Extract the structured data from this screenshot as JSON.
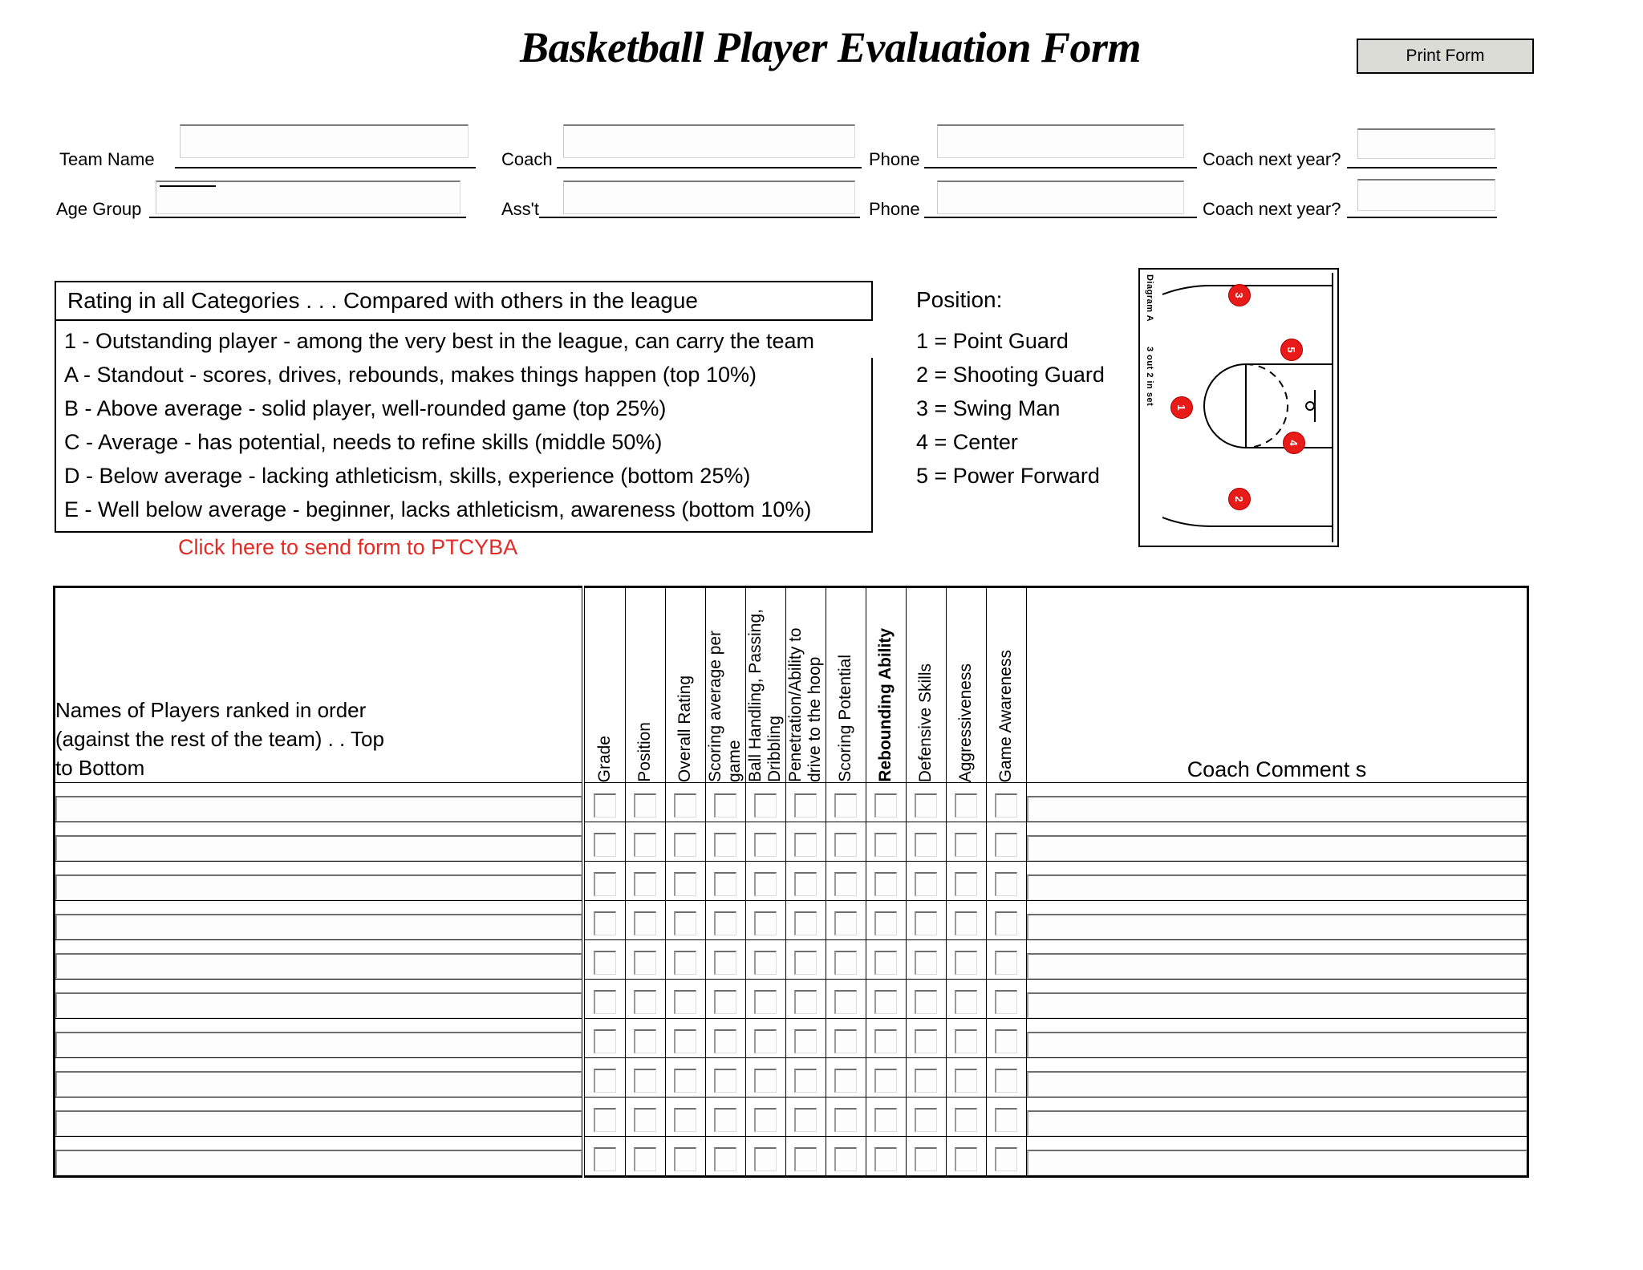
{
  "title": "Basketball Player Evaluation Form",
  "print_button": "Print Form",
  "header_fields": {
    "team_name_label": "Team Name",
    "age_group_label": "Age Group",
    "coach_label": "Coach",
    "asst_label": "Ass't",
    "phone_label_1": "Phone",
    "phone_label_2": "Phone",
    "coach_next_year_label_1": "Coach next year?",
    "coach_next_year_label_2": "Coach next year?",
    "team_name_value": "",
    "age_group_value": "",
    "coach_value": "",
    "asst_value": "",
    "phone_1_value": "",
    "phone_2_value": "",
    "coach_next_year_1_value": "",
    "coach_next_year_2_value": ""
  },
  "rating_box": {
    "heading": "Rating in all Categories . . . Compared with others in the league",
    "lines": [
      "1 - Outstanding player - among the very best in the league, can carry the team",
      "A - Standout - scores, drives, rebounds, makes things happen (top 10%)",
      "B - Above average - solid player, well-rounded game (top 25%)",
      "C - Average - has potential, needs to refine skills (middle 50%)",
      "D - Below average - lacking athleticism, skills, experience (bottom 25%)",
      "E - Well below average - beginner, lacks athleticism, awareness (bottom 10%)"
    ]
  },
  "position_box": {
    "title": "Position:",
    "lines": [
      "1 = Point Guard",
      "2 = Shooting Guard",
      "3 = Swing Man",
      "4 = Center",
      "5 = Power Forward"
    ]
  },
  "send_link": "Click here to send form to PTCYBA",
  "link_color": "#e12d26",
  "diagram": {
    "caption_line_1": "Diagram A",
    "caption_line_2": "3 out 2 in set",
    "players": [
      "1",
      "2",
      "3",
      "4",
      "5"
    ]
  },
  "table": {
    "names_header": [
      "Names of Players ranked in order",
      "(against the rest of the team) . . Top",
      "to Bottom"
    ],
    "columns": [
      {
        "label": "Grade",
        "bold": false
      },
      {
        "label": "Position",
        "bold": false
      },
      {
        "label": "Overall Rating",
        "bold": false
      },
      {
        "label": "Scoring average per game",
        "bold": false
      },
      {
        "label": "Ball Handling, Passing, Dribbling",
        "bold": false
      },
      {
        "label": "Penetration/Ability to drive to the hoop",
        "bold": false
      },
      {
        "label": "Scoring Potential",
        "bold": false
      },
      {
        "label": "Rebounding Ability",
        "bold": true
      },
      {
        "label": "Defensive Skills",
        "bold": false
      },
      {
        "label": "Aggressiveness",
        "bold": false
      },
      {
        "label": "Game Awareness",
        "bold": false
      }
    ],
    "comments_header": "Coach Comment s",
    "row_count": 10,
    "rows": [
      {
        "name": "",
        "values": [
          "",
          "",
          "",
          "",
          "",
          "",
          "",
          "",
          "",
          "",
          ""
        ],
        "comment": ""
      },
      {
        "name": "",
        "values": [
          "",
          "",
          "",
          "",
          "",
          "",
          "",
          "",
          "",
          "",
          ""
        ],
        "comment": ""
      },
      {
        "name": "",
        "values": [
          "",
          "",
          "",
          "",
          "",
          "",
          "",
          "",
          "",
          "",
          ""
        ],
        "comment": ""
      },
      {
        "name": "",
        "values": [
          "",
          "",
          "",
          "",
          "",
          "",
          "",
          "",
          "",
          "",
          ""
        ],
        "comment": ""
      },
      {
        "name": "",
        "values": [
          "",
          "",
          "",
          "",
          "",
          "",
          "",
          "",
          "",
          "",
          ""
        ],
        "comment": ""
      },
      {
        "name": "",
        "values": [
          "",
          "",
          "",
          "",
          "",
          "",
          "",
          "",
          "",
          "",
          ""
        ],
        "comment": ""
      },
      {
        "name": "",
        "values": [
          "",
          "",
          "",
          "",
          "",
          "",
          "",
          "",
          "",
          "",
          ""
        ],
        "comment": ""
      },
      {
        "name": "",
        "values": [
          "",
          "",
          "",
          "",
          "",
          "",
          "",
          "",
          "",
          "",
          ""
        ],
        "comment": ""
      },
      {
        "name": "",
        "values": [
          "",
          "",
          "",
          "",
          "",
          "",
          "",
          "",
          "",
          "",
          ""
        ],
        "comment": ""
      },
      {
        "name": "",
        "values": [
          "",
          "",
          "",
          "",
          "",
          "",
          "",
          "",
          "",
          "",
          ""
        ],
        "comment": ""
      }
    ]
  }
}
